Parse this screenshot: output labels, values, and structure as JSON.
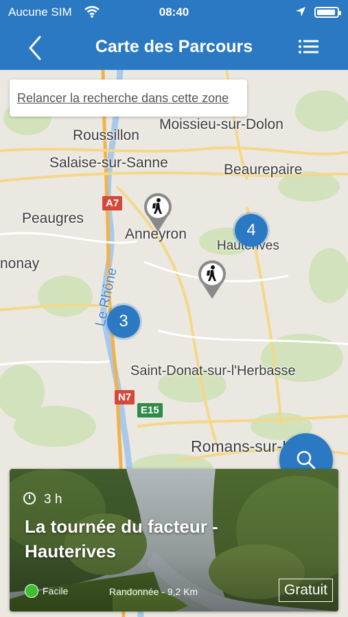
{
  "status": {
    "carrier": "Aucune SIM",
    "time": "08:40"
  },
  "nav": {
    "title": "Carte des Parcours",
    "back_icon": "chevron-left-icon",
    "list_icon": "list-icon"
  },
  "map": {
    "search_zone_label": "Relancer la recherche dans cette zone",
    "places": [
      {
        "name": "Roussillon"
      },
      {
        "name": "Moissieu-sur-Dolon"
      },
      {
        "name": "Salaise-sur-Sanne"
      },
      {
        "name": "Beaurepaire"
      },
      {
        "name": "Peaugres"
      },
      {
        "name": "Anneyron"
      },
      {
        "name": "Hauterives"
      },
      {
        "name": "nonay"
      },
      {
        "name": "Saint-Donat-sur-l'Herbasse"
      },
      {
        "name": "Romans-sur-Isère"
      }
    ],
    "river": "Le Rhône",
    "roads": [
      "A7",
      "N7",
      "E15"
    ],
    "clusters": [
      "4",
      "3"
    ],
    "colors": {
      "primary": "#2a79c2",
      "easy": "#3dbf2e"
    }
  },
  "card": {
    "duration": "3 h",
    "title": "La tournée du facteur - Hauterives",
    "difficulty": "Facile",
    "meta": "Randonnée - 9,2 Km",
    "price": "Gratuit"
  }
}
